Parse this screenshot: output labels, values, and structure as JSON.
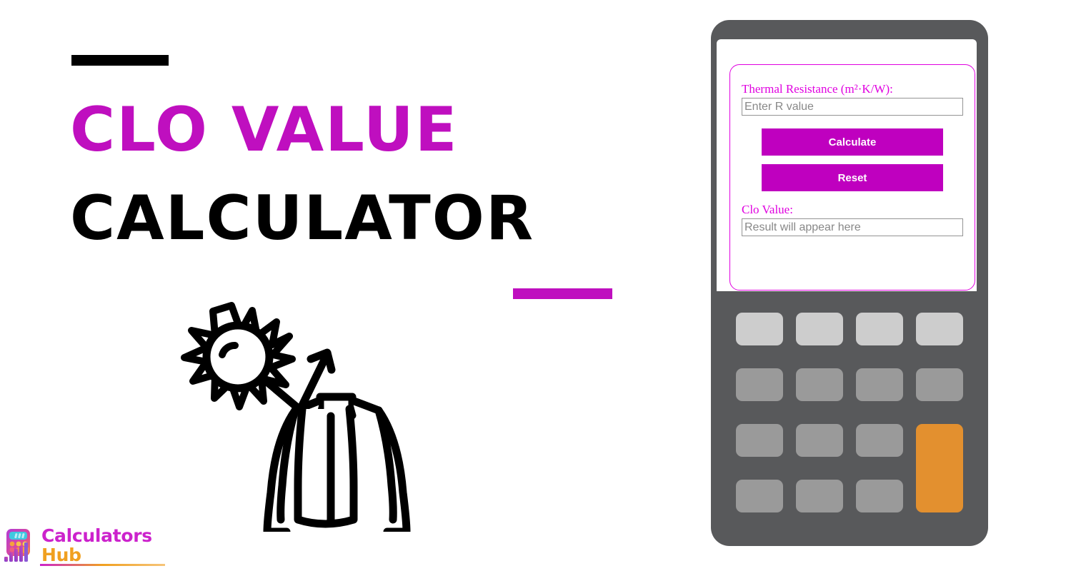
{
  "page": {
    "background_color": "#ffffff",
    "accent_magenta": "#bf0fbf",
    "accent_black": "#000000"
  },
  "hero": {
    "rule_top_color": "#000000",
    "rule_mid_color": "#bf0fbf",
    "title_line1": "CLO VALUE",
    "title_line2": "CALCULATOR",
    "title_line1_color": "#bf0fbf",
    "title_line2_color": "#000000",
    "illustration_name": "sun-arrow-jacket-line-icon"
  },
  "logo": {
    "word1": "Calculators",
    "word2": "Hub",
    "word1_color": "#cc22cc",
    "word2_color": "#f0a020",
    "icon_name": "calculator-bars-logo-icon"
  },
  "calculator": {
    "frame_color": "#58595b",
    "panel_color": "#ffffff",
    "form_border_color": "#e000e0",
    "form": {
      "input_label": "Thermal Resistance (m²·K/W):",
      "input_value": "",
      "input_placeholder": "Enter R value",
      "calculate_label": "Calculate",
      "reset_label": "Reset",
      "result_label": "Clo Value:",
      "result_value": "",
      "result_placeholder": "Result will appear here",
      "button_color": "#bf00bf",
      "button_text_color": "#ffffff"
    },
    "keypad": {
      "rows": 4,
      "columns": 4,
      "key_color_light": "#cdcdcd",
      "key_color_default": "#9a9a9a",
      "key_color_accent": "#e3902f",
      "keys": [
        {
          "name": "key-r1c1",
          "style": "light",
          "label": ""
        },
        {
          "name": "key-r1c2",
          "style": "light",
          "label": ""
        },
        {
          "name": "key-r1c3",
          "style": "light",
          "label": ""
        },
        {
          "name": "key-r1c4",
          "style": "light",
          "label": ""
        },
        {
          "name": "key-r2c1",
          "style": "default",
          "label": ""
        },
        {
          "name": "key-r2c2",
          "style": "default",
          "label": ""
        },
        {
          "name": "key-r2c3",
          "style": "default",
          "label": ""
        },
        {
          "name": "key-r2c4",
          "style": "default",
          "label": ""
        },
        {
          "name": "key-r3c1",
          "style": "default",
          "label": ""
        },
        {
          "name": "key-r3c2",
          "style": "default",
          "label": ""
        },
        {
          "name": "key-r3c3",
          "style": "default",
          "label": ""
        },
        {
          "name": "key-equals",
          "style": "accent",
          "label": ""
        },
        {
          "name": "key-r4c1",
          "style": "default",
          "label": ""
        },
        {
          "name": "key-r4c2",
          "style": "default",
          "label": ""
        },
        {
          "name": "key-r4c3",
          "style": "default",
          "label": ""
        }
      ]
    }
  }
}
